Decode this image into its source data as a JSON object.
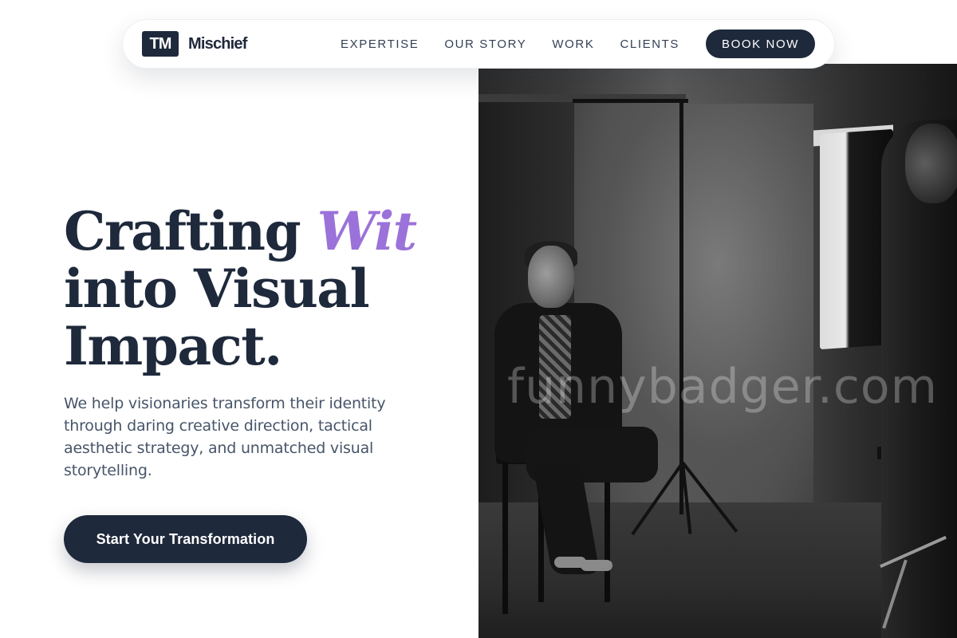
{
  "brand": {
    "logo_text": "TM",
    "name": "Mischief"
  },
  "nav": {
    "links": [
      {
        "label": "EXPERTISE"
      },
      {
        "label": "OUR STORY"
      },
      {
        "label": "WORK"
      },
      {
        "label": "CLIENTS"
      }
    ],
    "cta_label": "BOOK NOW"
  },
  "hero": {
    "title_part1": "Crafting ",
    "title_accent": "Wit",
    "title_line2": "into Visual",
    "title_line3": "Impact.",
    "subtitle": "We help visionaries transform their identity through daring creative direction, tactical aesthetic strategy, and unmatched visual storytelling.",
    "cta_label": "Start Your Transformation"
  },
  "photo": {
    "watermark": "funnybadger.com"
  },
  "colors": {
    "primary": "#1e293b",
    "accent": "#9b72d9",
    "body_text": "#475569"
  }
}
